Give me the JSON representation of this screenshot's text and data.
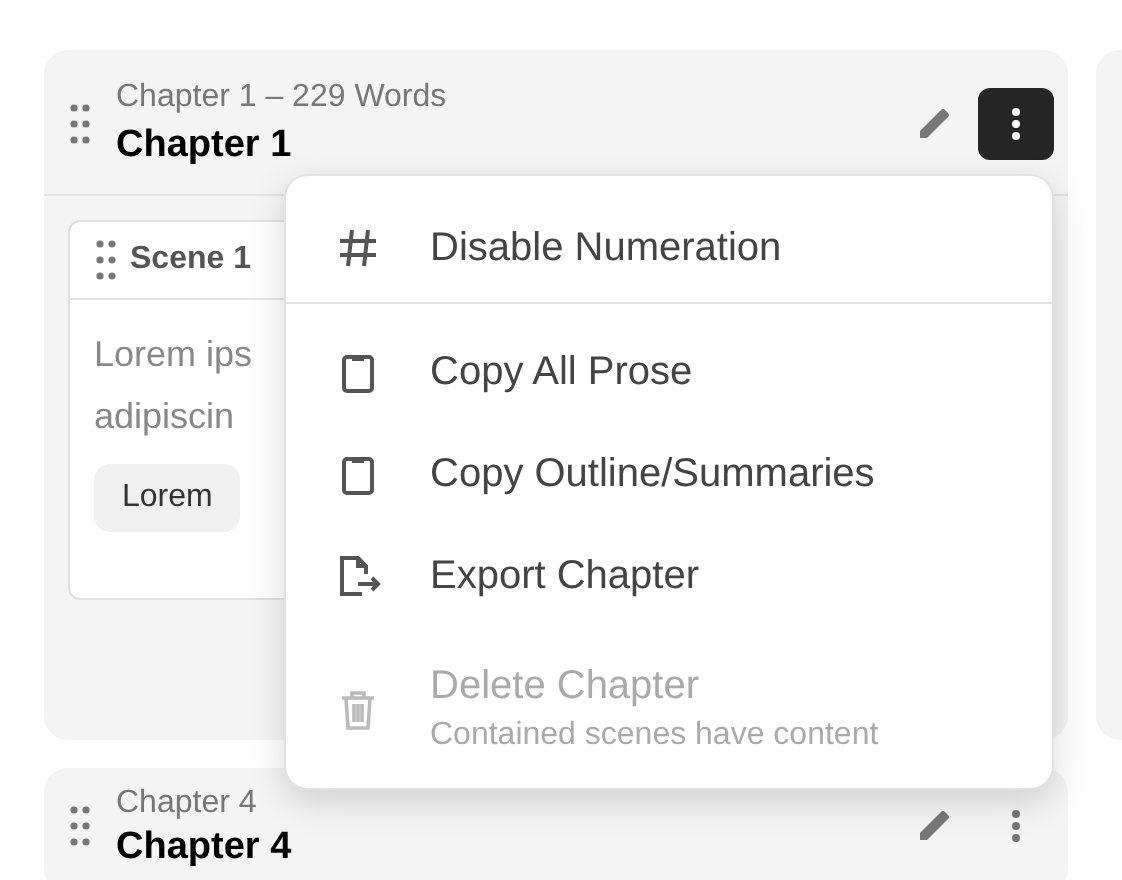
{
  "chapters": [
    {
      "subtitle": "Chapter 1 –  229 Words",
      "title": "Chapter 1",
      "menu_open": true,
      "scenes": [
        {
          "title": "Scene 1",
          "lines": [
            "Lorem ips",
            "adipiscin"
          ],
          "tags": [
            "Lorem"
          ]
        }
      ]
    },
    {
      "subtitle": "Chapter 4",
      "title": "Chapter 4",
      "menu_open": false
    }
  ],
  "menu": {
    "items": [
      {
        "kind": "numbering",
        "label": "Disable Numeration",
        "disabled": false
      },
      {
        "kind": "copy",
        "label": "Copy All Prose",
        "disabled": false
      },
      {
        "kind": "copy",
        "label": "Copy Outline/Summaries",
        "disabled": false
      },
      {
        "kind": "export",
        "label": "Export Chapter",
        "disabled": false
      },
      {
        "kind": "delete",
        "label": "Delete Chapter",
        "note": "Contained scenes have content",
        "disabled": true
      }
    ]
  }
}
